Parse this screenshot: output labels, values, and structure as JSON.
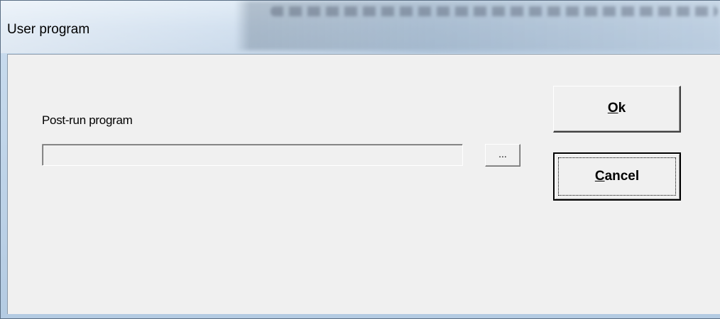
{
  "window": {
    "title": "User program"
  },
  "form": {
    "post_run_label": "Post-run program",
    "post_run_value": "",
    "browse_label": "..."
  },
  "buttons": {
    "ok_accel": "O",
    "ok_rest": "k",
    "cancel_accel": "C",
    "cancel_rest": "ancel"
  },
  "colors": {
    "dialog_background": "#f0f0f0",
    "title_bar": "#c3d6ea",
    "text": "#000000"
  },
  "icons": {
    "browse": "ellipsis"
  }
}
